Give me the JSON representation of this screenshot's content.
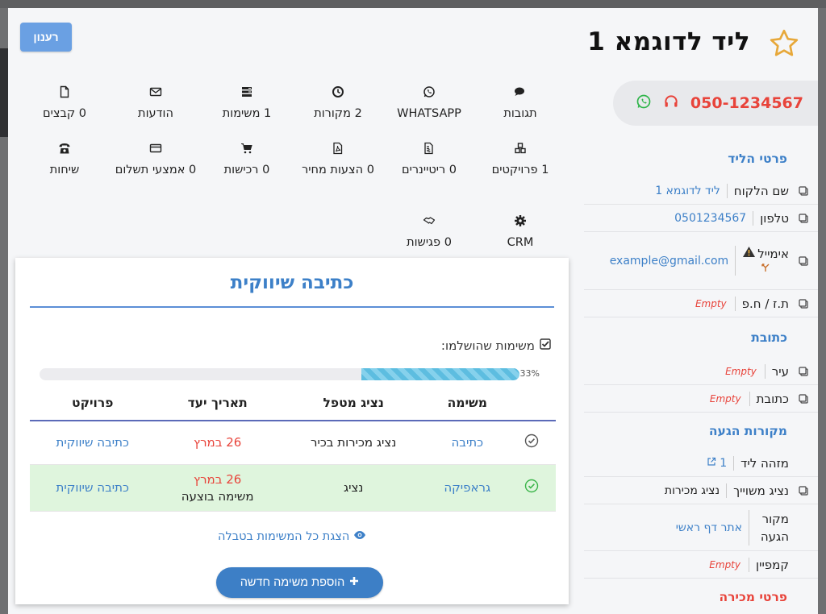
{
  "header": {
    "refresh_label": "רענון",
    "lead_title": "ליד לדוגמא 1",
    "phone": "050-1234567"
  },
  "grid": [
    {
      "icon": "comments-icon",
      "label": "תגובות"
    },
    {
      "icon": "whatsapp-icon",
      "label": "WHATSAPP"
    },
    {
      "icon": "clock-icon",
      "label": "2 מקורות"
    },
    {
      "icon": "tasks-icon",
      "label": "1 משימות"
    },
    {
      "icon": "envelope-icon",
      "label": "הודעות"
    },
    {
      "icon": "file-icon",
      "label": "0 קבצים"
    },
    {
      "icon": "cubes-icon",
      "label": "1 פרויקטים"
    },
    {
      "icon": "invoice-icon",
      "label": "0 ריטיינרים"
    },
    {
      "icon": "pdf-icon",
      "label": "0 הצעות מחיר"
    },
    {
      "icon": "cart-icon",
      "label": "0 רכישות"
    },
    {
      "icon": "credit-card-icon",
      "label": "0 אמצעי תשלום"
    },
    {
      "icon": "phone-icon",
      "label": "שיחות"
    },
    {
      "icon": "gear-icon",
      "label": "CRM"
    },
    {
      "icon": "handshake-icon",
      "label": "0 פגישות"
    }
  ],
  "card": {
    "title": "כתיבה שיווקית",
    "done_label": "משימות שהושלמו:",
    "progress_percent": 33,
    "progress_text": "33%",
    "columns": [
      "משימה",
      "נציג מטפל",
      "תאריך יעד",
      "פרויקט"
    ],
    "rows": [
      {
        "task": "כתיבה",
        "agent": "נציג מכירות בכיר",
        "due": "26 במרץ",
        "status": "",
        "project": "כתיבה שיווקית",
        "done": false
      },
      {
        "task": "גראפיקה",
        "agent": "נציג",
        "due": "26 במרץ",
        "status": "משימה בוצעה",
        "project": "כתיבה שיווקית",
        "done": true
      }
    ],
    "view_all_label": "הצגת כל המשימות בטבלה",
    "add_task_label": "הוספת משימה חדשה"
  },
  "right_panel": {
    "lead_details_title": "פרטי הליד",
    "fields": {
      "customer_name": {
        "label": "שם הלקוח",
        "value": "ליד לדוגמא 1"
      },
      "phone": {
        "label": "טלפון",
        "value": "0501234567"
      },
      "email": {
        "label": "אימייל",
        "value": "example@gmail.com"
      },
      "id": {
        "label": "ת.ז / ח.פ",
        "value": "Empty"
      }
    },
    "address_title": "כתובת",
    "address_fields": {
      "city": {
        "label": "עיר",
        "value": "Empty"
      },
      "address": {
        "label": "כתובת",
        "value": "Empty"
      }
    },
    "sources_title": "מקורות הגעה",
    "source_fields": {
      "lead_id": {
        "label": "מזהה ליד",
        "value": "1"
      },
      "agent": {
        "label": "נציג משוייך",
        "value": "נציג מכירות"
      },
      "source": {
        "label": "מקור הגעה",
        "value": "אתר דף ראשי"
      },
      "campaign": {
        "label": "קמפיין",
        "value": "Empty"
      }
    },
    "sale_title": "פרטי מכירה"
  },
  "colors": {
    "accent_blue": "#3d80c8",
    "accent_red": "#e8433a",
    "done_row_green": "#dff5dd",
    "whatsapp_green": "#2fb54a"
  }
}
